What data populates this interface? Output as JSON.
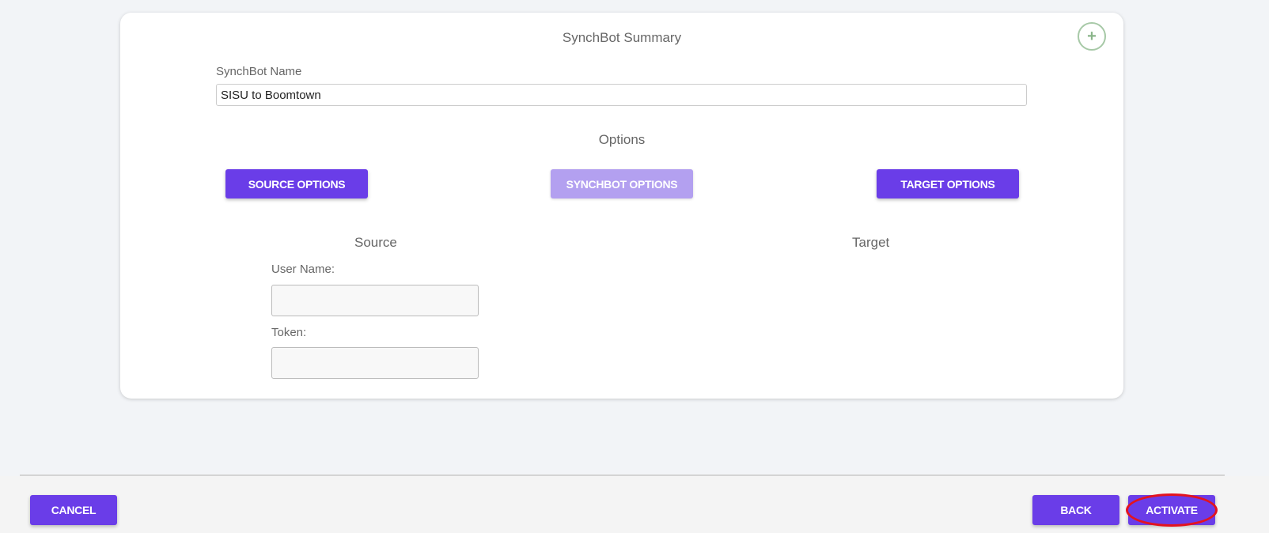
{
  "summary": {
    "title": "SynchBot Summary",
    "add_symbol": "+"
  },
  "name_field": {
    "label": "SynchBot Name",
    "value": "SISU to Boomtown"
  },
  "options": {
    "label": "Options",
    "source_button": "SOURCE OPTIONS",
    "synchbot_button": "SYNCHBOT OPTIONS",
    "target_button": "TARGET OPTIONS"
  },
  "source": {
    "heading": "Source",
    "username_label": "User Name:",
    "username_value": "",
    "token_label": "Token:",
    "token_value": ""
  },
  "target": {
    "heading": "Target"
  },
  "footer": {
    "cancel_label": "CANCEL",
    "back_label": "BACK",
    "activate_label": "ACTIVATE"
  },
  "colors": {
    "primary": "#6a3de8",
    "primary_disabled": "#b3a0f0",
    "highlight": "#e4131e",
    "add_button": "#8ab58a"
  }
}
